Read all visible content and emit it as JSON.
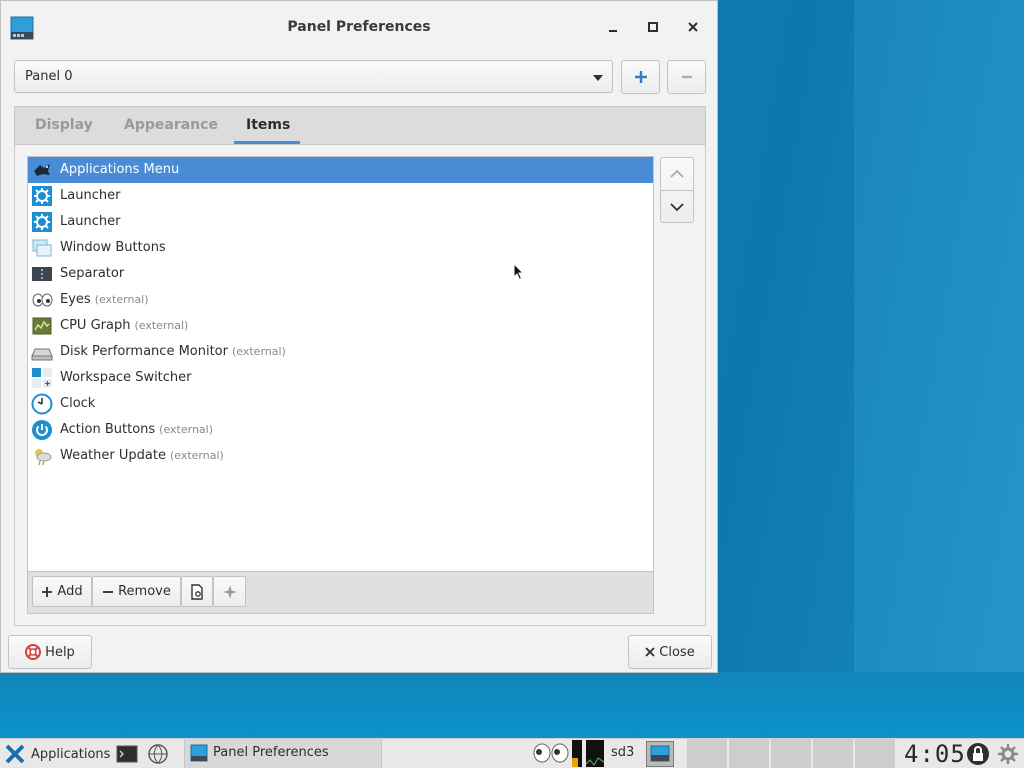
{
  "window": {
    "title": "Panel Preferences",
    "buttons": {
      "minimize": "minimize-icon",
      "maximize": "maximize-icon",
      "close": "close-icon"
    }
  },
  "panel_selector": {
    "selected": "Panel 0",
    "add_icon": "plus-icon",
    "remove_icon": "minus-icon"
  },
  "tabs": [
    {
      "label": "Display",
      "active": false
    },
    {
      "label": "Appearance",
      "active": false
    },
    {
      "label": "Items",
      "active": true
    }
  ],
  "items": [
    {
      "label": "Applications Menu",
      "external": "",
      "icon": "applications-menu-icon",
      "selected": true
    },
    {
      "label": "Launcher",
      "external": "",
      "icon": "launcher-gear-icon"
    },
    {
      "label": "Launcher",
      "external": "",
      "icon": "launcher-gear-icon"
    },
    {
      "label": "Window Buttons",
      "external": "",
      "icon": "window-buttons-icon"
    },
    {
      "label": "Separator",
      "external": "",
      "icon": "separator-icon"
    },
    {
      "label": "Eyes",
      "external": "(external)",
      "icon": "eyes-icon"
    },
    {
      "label": "CPU Graph",
      "external": "(external)",
      "icon": "cpu-graph-icon"
    },
    {
      "label": "Disk Performance Monitor",
      "external": "(external)",
      "icon": "disk-icon"
    },
    {
      "label": "Workspace Switcher",
      "external": "",
      "icon": "workspace-switcher-icon"
    },
    {
      "label": "Clock",
      "external": "",
      "icon": "clock-icon"
    },
    {
      "label": "Action Buttons",
      "external": "(external)",
      "icon": "power-icon"
    },
    {
      "label": "Weather Update",
      "external": "(external)",
      "icon": "weather-icon"
    }
  ],
  "list_toolbar": {
    "add": "Add",
    "remove": "Remove"
  },
  "footer": {
    "help": "Help",
    "close": "Close"
  },
  "taskbar": {
    "apps_label": "Applications",
    "task_label": "Panel Preferences",
    "disk_label": "sd3",
    "clock": "4:05"
  },
  "colors": {
    "accent": "#4a8bd6",
    "selected_row": "#4a8bd6",
    "desktop": "#1787b8"
  }
}
